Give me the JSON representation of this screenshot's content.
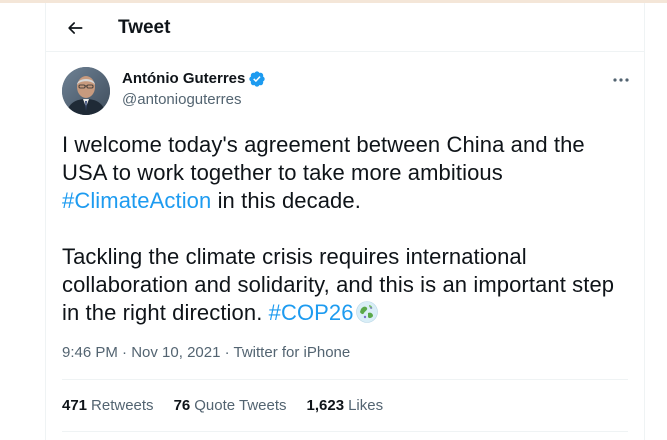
{
  "header": {
    "title": "Tweet"
  },
  "author": {
    "name": "António Guterres",
    "handle": "@antonioguterres"
  },
  "tweet": {
    "para1_before": "I welcome today's agreement between China and the USA to work together to take more ambitious ",
    "hashtag1": "#ClimateAction",
    "para1_after": " in this decade.",
    "para2_before": "Tackling the climate crisis requires international collaboration and solidarity, and this is an important step in the right direction. ",
    "hashtag2": "#COP26"
  },
  "meta": {
    "time": "9:46 PM",
    "sep1": " · ",
    "date": "Nov 10, 2021",
    "sep2": " · ",
    "source": "Twitter for iPhone"
  },
  "stats": {
    "retweets_count": "471",
    "retweets_label": "Retweets",
    "quotes_count": "76",
    "quotes_label": "Quote Tweets",
    "likes_count": "1,623",
    "likes_label": "Likes"
  },
  "colors": {
    "accent": "#1d9bf0",
    "text": "#0f1419",
    "secondary": "#536471",
    "border": "#eff3f4"
  },
  "icons": {
    "back": "arrow-left-icon",
    "verified": "verified-badge-icon",
    "more": "more-options-icon",
    "emoji": "globe-emoji-icon"
  }
}
